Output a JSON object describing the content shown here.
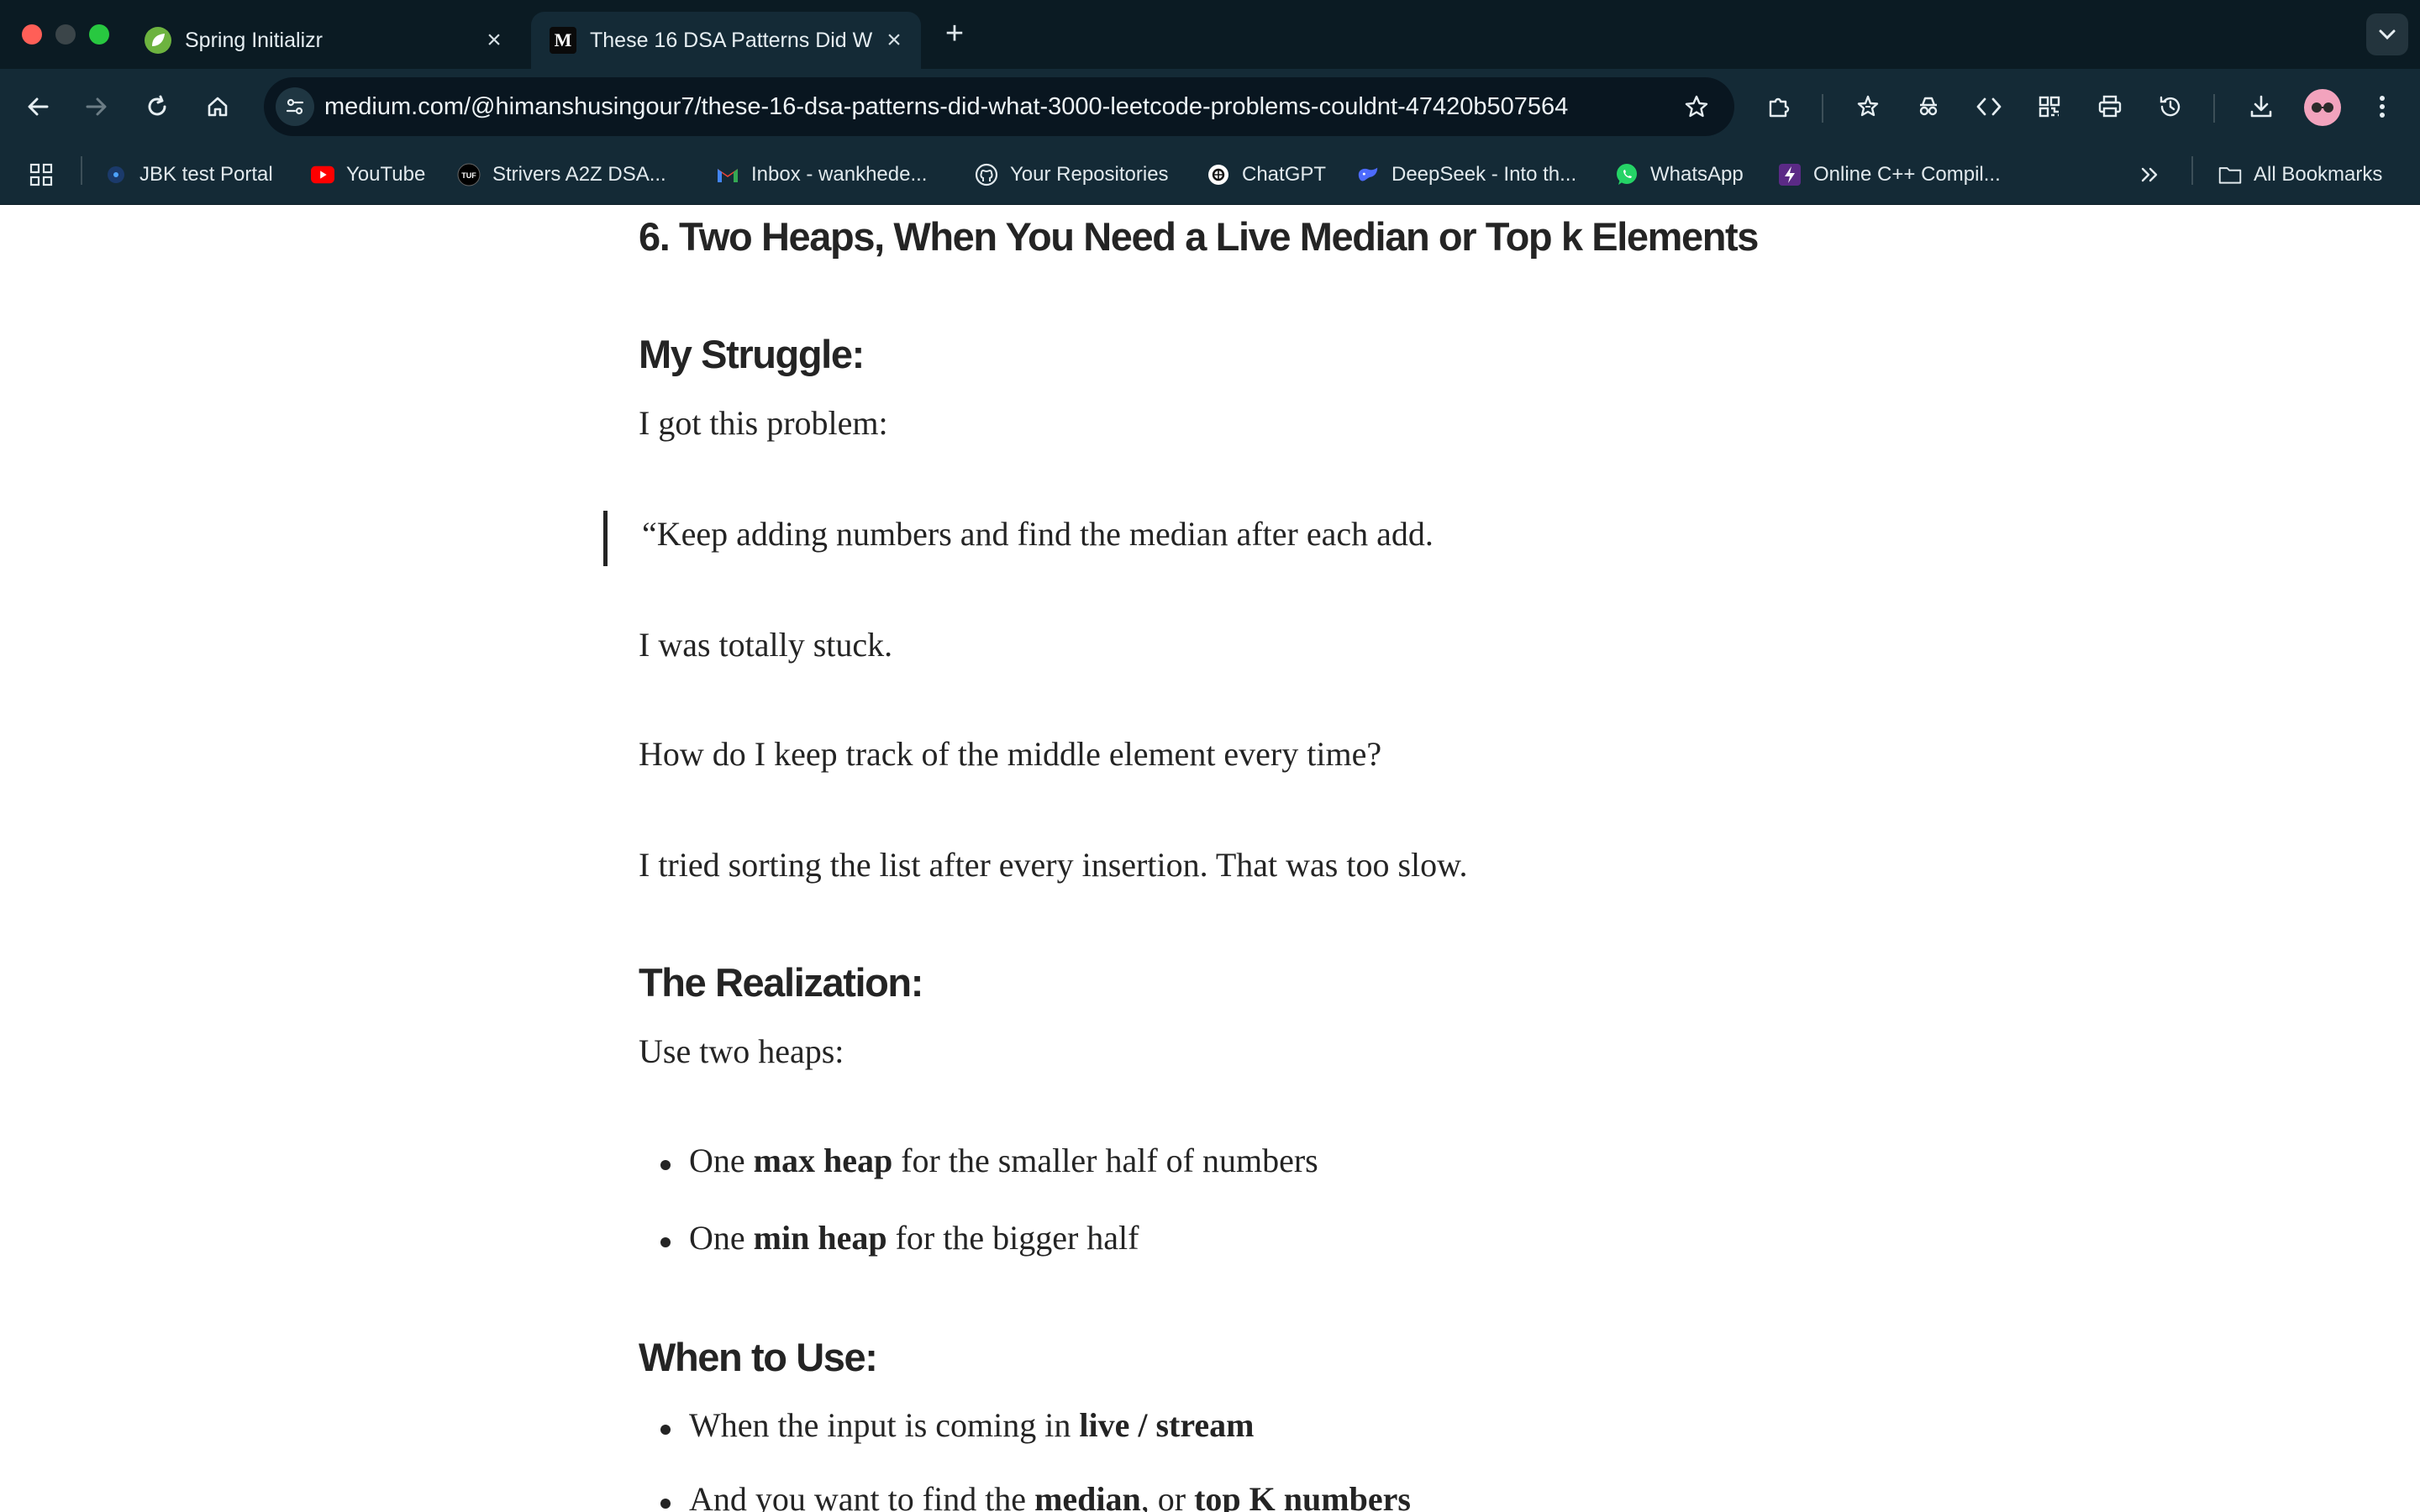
{
  "browser": {
    "tabs": [
      {
        "title": "Spring Initializr",
        "favicon": "spring-leaf-icon",
        "active": false
      },
      {
        "title": "These 16 DSA Patterns Did W",
        "favicon": "medium-logo-icon",
        "favicon_text": "M",
        "active": true
      }
    ],
    "url": "medium.com/@himanshusingour7/these-16-dsa-patterns-did-what-3000-leetcode-problems-couldnt-47420b507564",
    "bookmarks": [
      {
        "label": "JBK test Portal",
        "icon": "jbk-icon"
      },
      {
        "label": "YouTube",
        "icon": "youtube-icon",
        "color": "#ff0000"
      },
      {
        "label": "Strivers A2Z DSA...",
        "icon": "tuf-icon"
      },
      {
        "label": "Inbox - wankhede...",
        "icon": "gmail-icon"
      },
      {
        "label": "Your Repositories",
        "icon": "github-icon"
      },
      {
        "label": "ChatGPT",
        "icon": "chatgpt-icon"
      },
      {
        "label": "DeepSeek - Into th...",
        "icon": "deepseek-icon"
      },
      {
        "label": "WhatsApp",
        "icon": "whatsapp-icon",
        "color": "#25d366"
      },
      {
        "label": "Online C++ Compil...",
        "icon": "bolt-icon"
      }
    ],
    "all_bookmarks_label": "All Bookmarks",
    "colors": {
      "tabstrip": "#0b1b23",
      "toolbar": "#142a36",
      "omnibox": "#091620",
      "text_light": "#e6eef2"
    }
  },
  "article": {
    "section_heading": "6. Two Heaps, When You Need a Live Median or Top k Elements",
    "struggle_heading": "My Struggle:",
    "struggle_intro": "I got this problem:",
    "quote": "“Keep adding numbers and find the median after each add.",
    "stuck": "I was totally stuck.",
    "question": "How do I keep track of the middle element every time?",
    "tried": "I tried sorting the list after every insertion. That was too slow.",
    "realization_heading": "The Realization:",
    "realization_intro": "Use two heaps:",
    "heaps": [
      {
        "pre": "One ",
        "bold": "max heap",
        "post": " for the smaller half of numbers"
      },
      {
        "pre": "One ",
        "bold": "min heap",
        "post": " for the bigger half"
      }
    ],
    "when_heading": "When to Use:",
    "when_items": [
      {
        "pre": "When the input is coming in ",
        "bold": "live / stream",
        "mid": "",
        "bold2": "",
        "post": ""
      },
      {
        "pre": "And you want to find the ",
        "bold": "median",
        "mid": ", or ",
        "bold2": "top K numbers",
        "post": ""
      }
    ],
    "text_color": "#242424"
  }
}
